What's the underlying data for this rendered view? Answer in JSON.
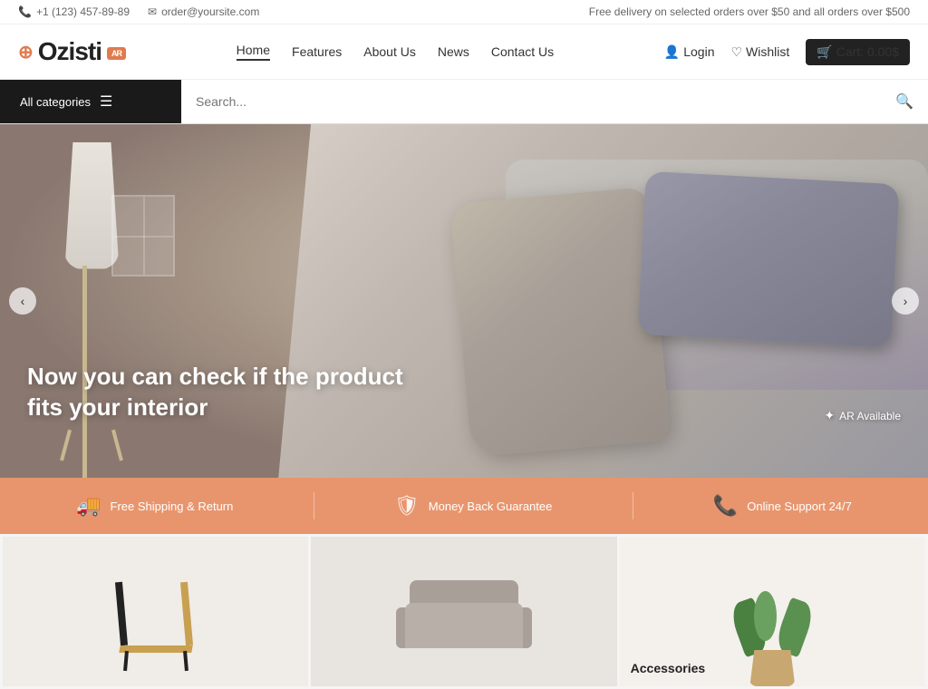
{
  "topbar": {
    "phone": "+1 (123) 457-89-89",
    "email": "order@yoursite.com",
    "promo": "Free delivery on selected orders over $50 and all orders over $500",
    "phone_icon": "📞",
    "email_icon": "✉"
  },
  "header": {
    "logo_text": "Ozisti",
    "logo_ar": "AR",
    "nav": {
      "home": "Home",
      "features": "Features",
      "about": "About Us",
      "news": "News",
      "contact": "Contact Us",
      "login": "Login",
      "wishlist": "Wishlist",
      "cart": "Cart: 0.00$"
    }
  },
  "search": {
    "all_categories": "All categories",
    "placeholder": "Search..."
  },
  "hero": {
    "headline_line1": "Now you can check if the product",
    "headline_line2": "fits your interior",
    "ar_badge": "AR Available",
    "arrow_left": "‹",
    "arrow_right": "›"
  },
  "features": {
    "items": [
      {
        "icon": "🚚",
        "label": "Free Shipping & Return"
      },
      {
        "icon": "🛡",
        "label": "Money Back Guarantee"
      },
      {
        "icon": "📞",
        "label": "Online Support 24/7"
      }
    ]
  },
  "products": {
    "cards": [
      {
        "id": "chair",
        "label": ""
      },
      {
        "id": "sofa",
        "label": ""
      },
      {
        "id": "plant",
        "label": "Accessories"
      }
    ]
  }
}
